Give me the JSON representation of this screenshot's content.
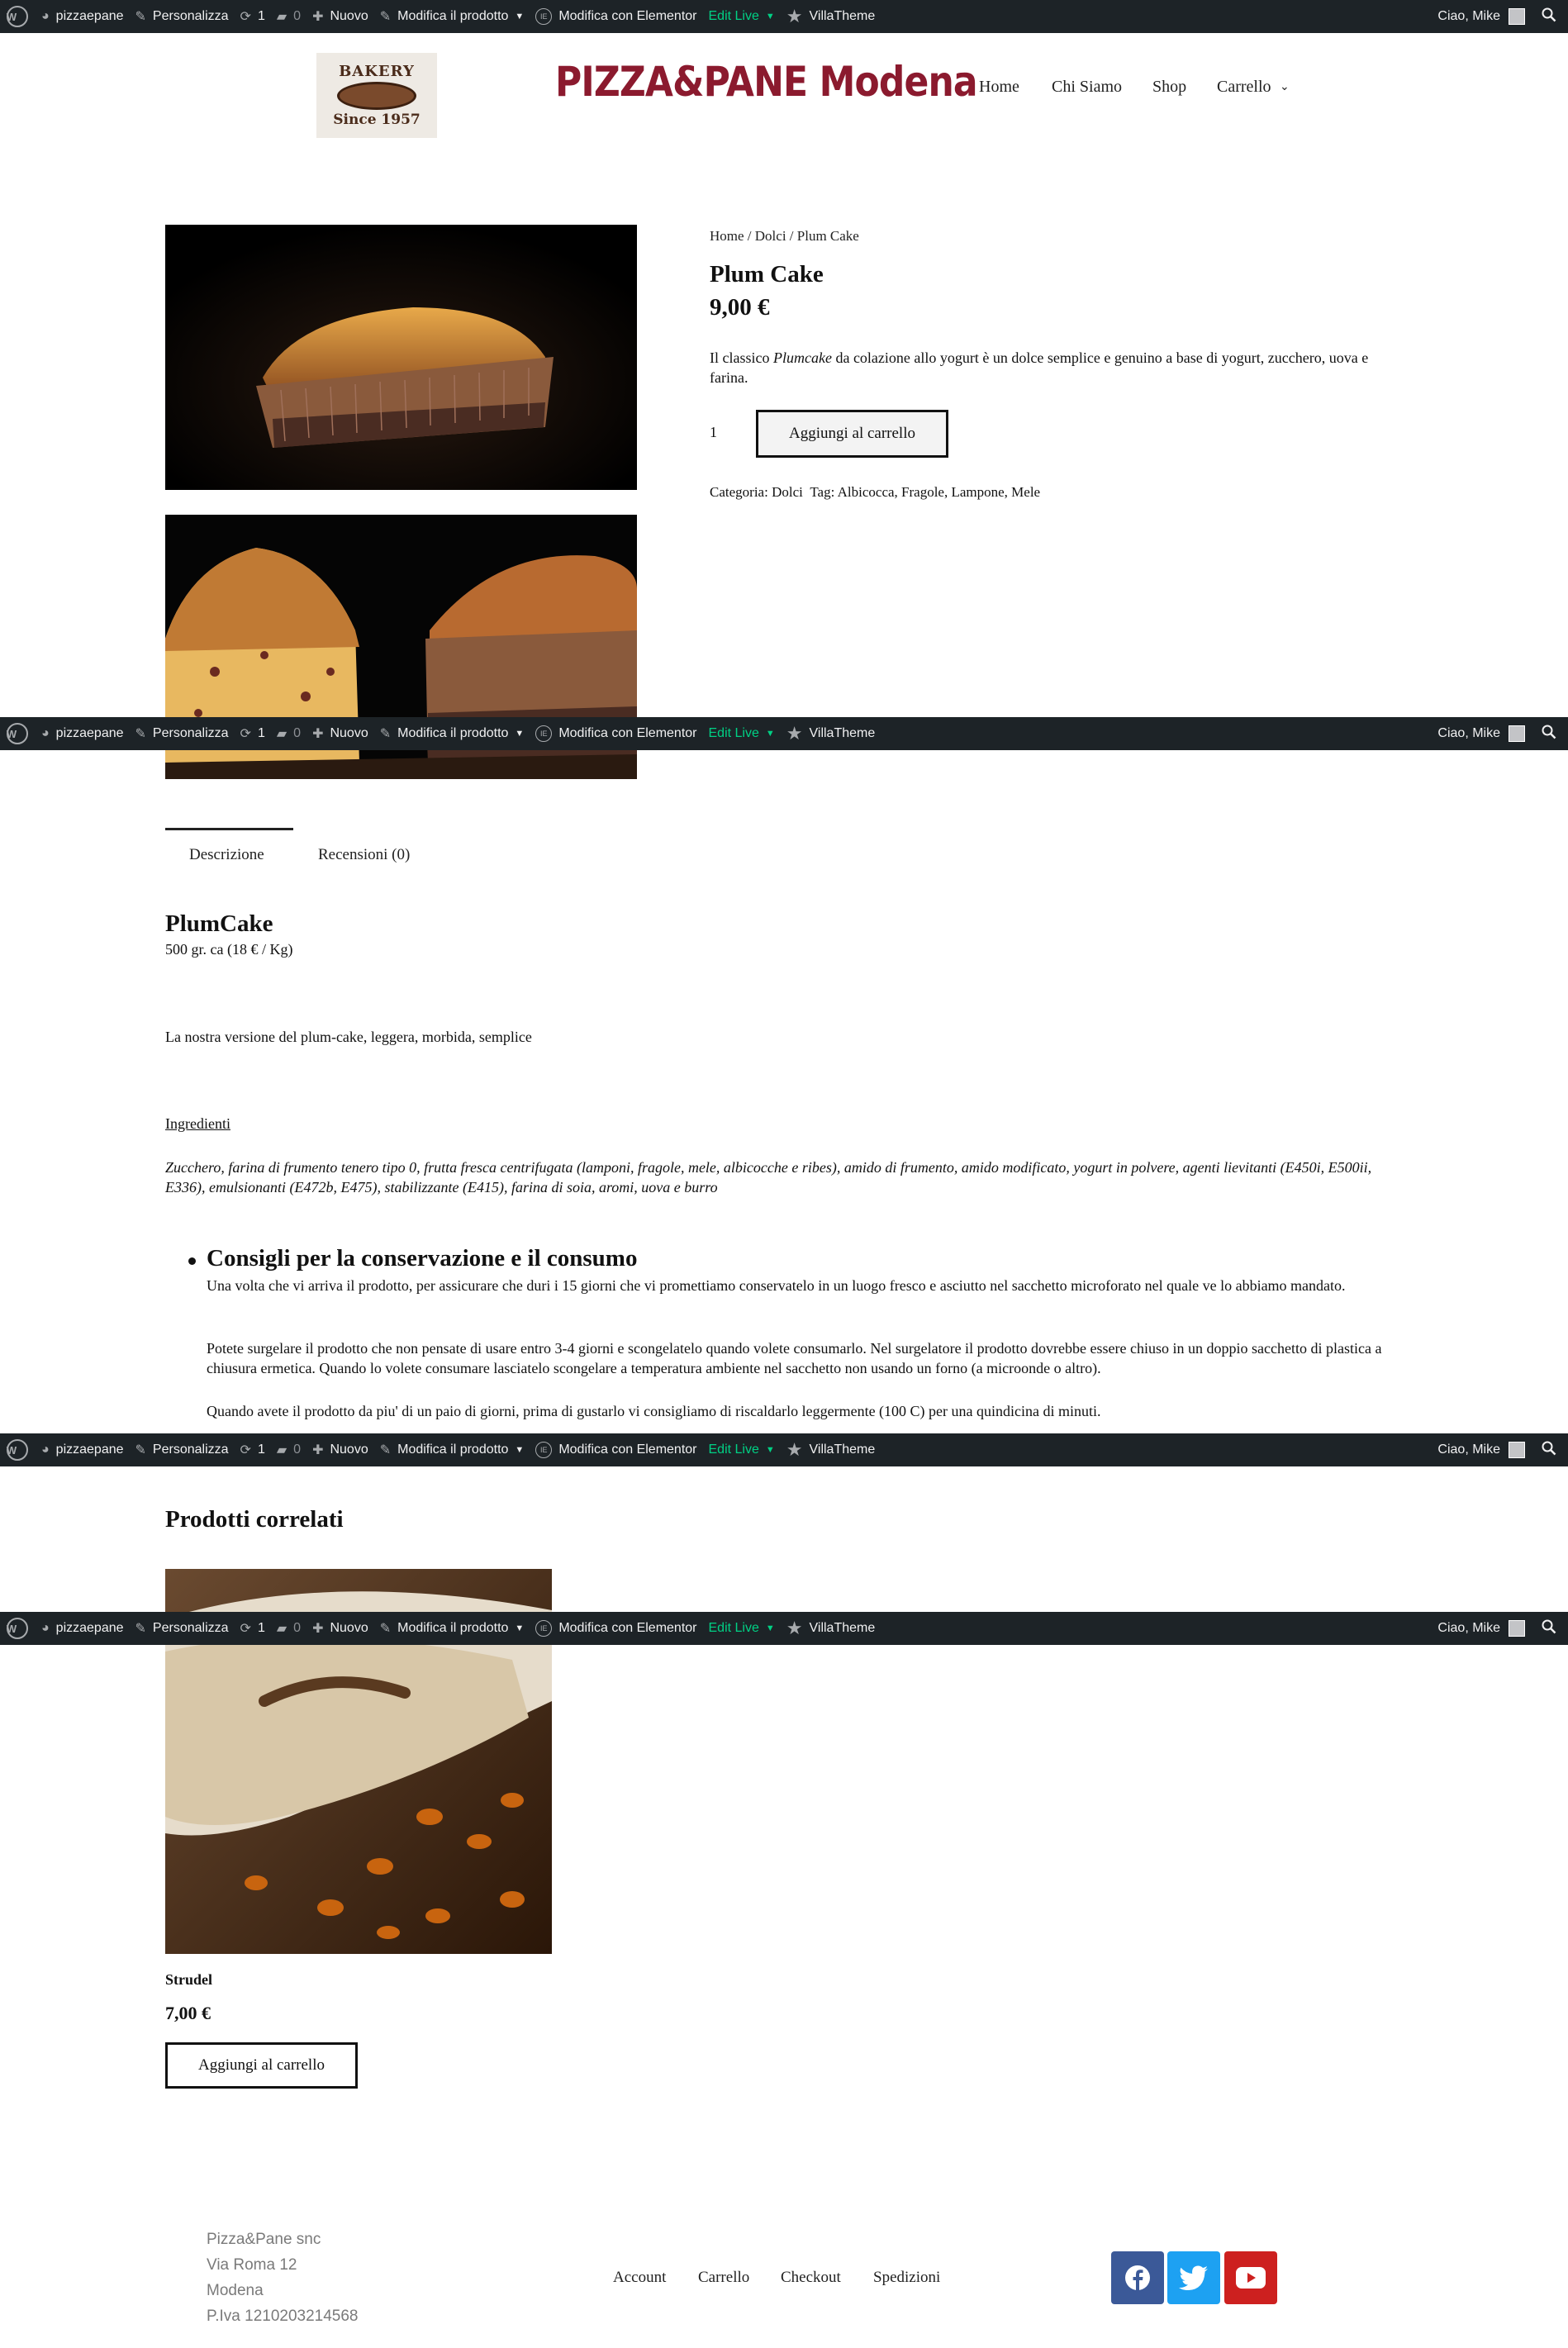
{
  "admin_bar": {
    "site_name": "pizzaepane",
    "customize": "Personalizza",
    "updates_count": "1",
    "comments_count": "0",
    "new": "Nuovo",
    "edit_product": "Modifica il prodotto",
    "elementor": "Modifica con Elementor",
    "edit_live": "Edit Live",
    "villatheme": "VillaTheme",
    "greeting": "Ciao, Mike",
    "elementor_badge": "IE"
  },
  "header": {
    "logo_top": "BAKERY",
    "logo_bottom": "Since 1957",
    "site_title": "PIZZA&PANE Modena",
    "nav": [
      "Home",
      "Chi Siamo",
      "Shop",
      "Carrello"
    ]
  },
  "product": {
    "breadcrumb": "Home / Dolci / Plum Cake",
    "title": "Plum Cake",
    "price": "9,00 €",
    "desc_before": "Il classico ",
    "desc_em": "Plumcake",
    "desc_after": " da colazione allo yogurt è un dolce semplice e genuino a base di yogurt, zucchero, uova e farina.",
    "quantity": "1",
    "add_to_cart": "Aggiungi al carrello",
    "category_label": "Categoria:",
    "category": "Dolci",
    "tag_label": "Tag:",
    "tags": "Albicocca, Fragole, Lampone, Mele"
  },
  "tabs": {
    "description": "Descrizione",
    "reviews": "Recensioni (0)"
  },
  "description": {
    "heading": "PlumCake",
    "weight": "500 gr. ca (18 € / Kg)",
    "intro": "La nostra versione del plum-cake, leggera, morbida, semplice",
    "ingredients_label": "Ingredienti",
    "ingredients": "Zucchero, farina di frumento tenero tipo 0, frutta fresca centrifugata (lamponi, fragole, mele, albicocche e ribes), amido di frumento, amido modificato, yogurt in polvere, agenti lievitanti (E450i, E500ii, E336), emulsionanti (E472b, E475), stabilizzante (E415), farina di soia, aromi, uova e burro",
    "conservation_heading": "Consigli per la conservazione e il consumo",
    "conservation_1": "Una volta che vi arriva il prodotto, per assicurare che duri i 15 giorni che vi promettiamo conservatelo in un luogo fresco e asciutto nel sacchetto microforato nel quale ve lo abbiamo mandato.",
    "conservation_2": "Potete surgelare il prodotto che non pensate di usare entro 3-4 giorni e scongelatelo quando volete consumarlo. Nel surgelatore il prodotto dovrebbe essere chiuso in un doppio sacchetto di plastica a chiusura ermetica. Quando lo volete consumare lasciatelo scongelare a temperatura ambiente nel sacchetto non usando un forno (a microonde o altro).",
    "conservation_3": "Quando avete il prodotto da piu' di un paio di giorni, prima di gustarlo vi consigliamo di riscaldarlo leggermente (100 C) per una quindicina di minuti."
  },
  "related": {
    "heading": "Prodotti correlati",
    "name": "Strudel",
    "price": "7,00 €",
    "add_to_cart": "Aggiungi al carrello"
  },
  "footer": {
    "company": "Pizza&Pane snc",
    "street": "Via Roma 12",
    "city": "Modena",
    "vat": "P.Iva 1210203214568",
    "links": [
      "Account",
      "Carrello",
      "Checkout",
      "Spedizioni"
    ]
  },
  "colors": {
    "admin_bar": "#1d2327",
    "site_title": "#8b1a2e",
    "edit_live": "#00d084",
    "facebook": "#3b5998",
    "twitter": "#1da1f2",
    "youtube": "#cd201f"
  }
}
